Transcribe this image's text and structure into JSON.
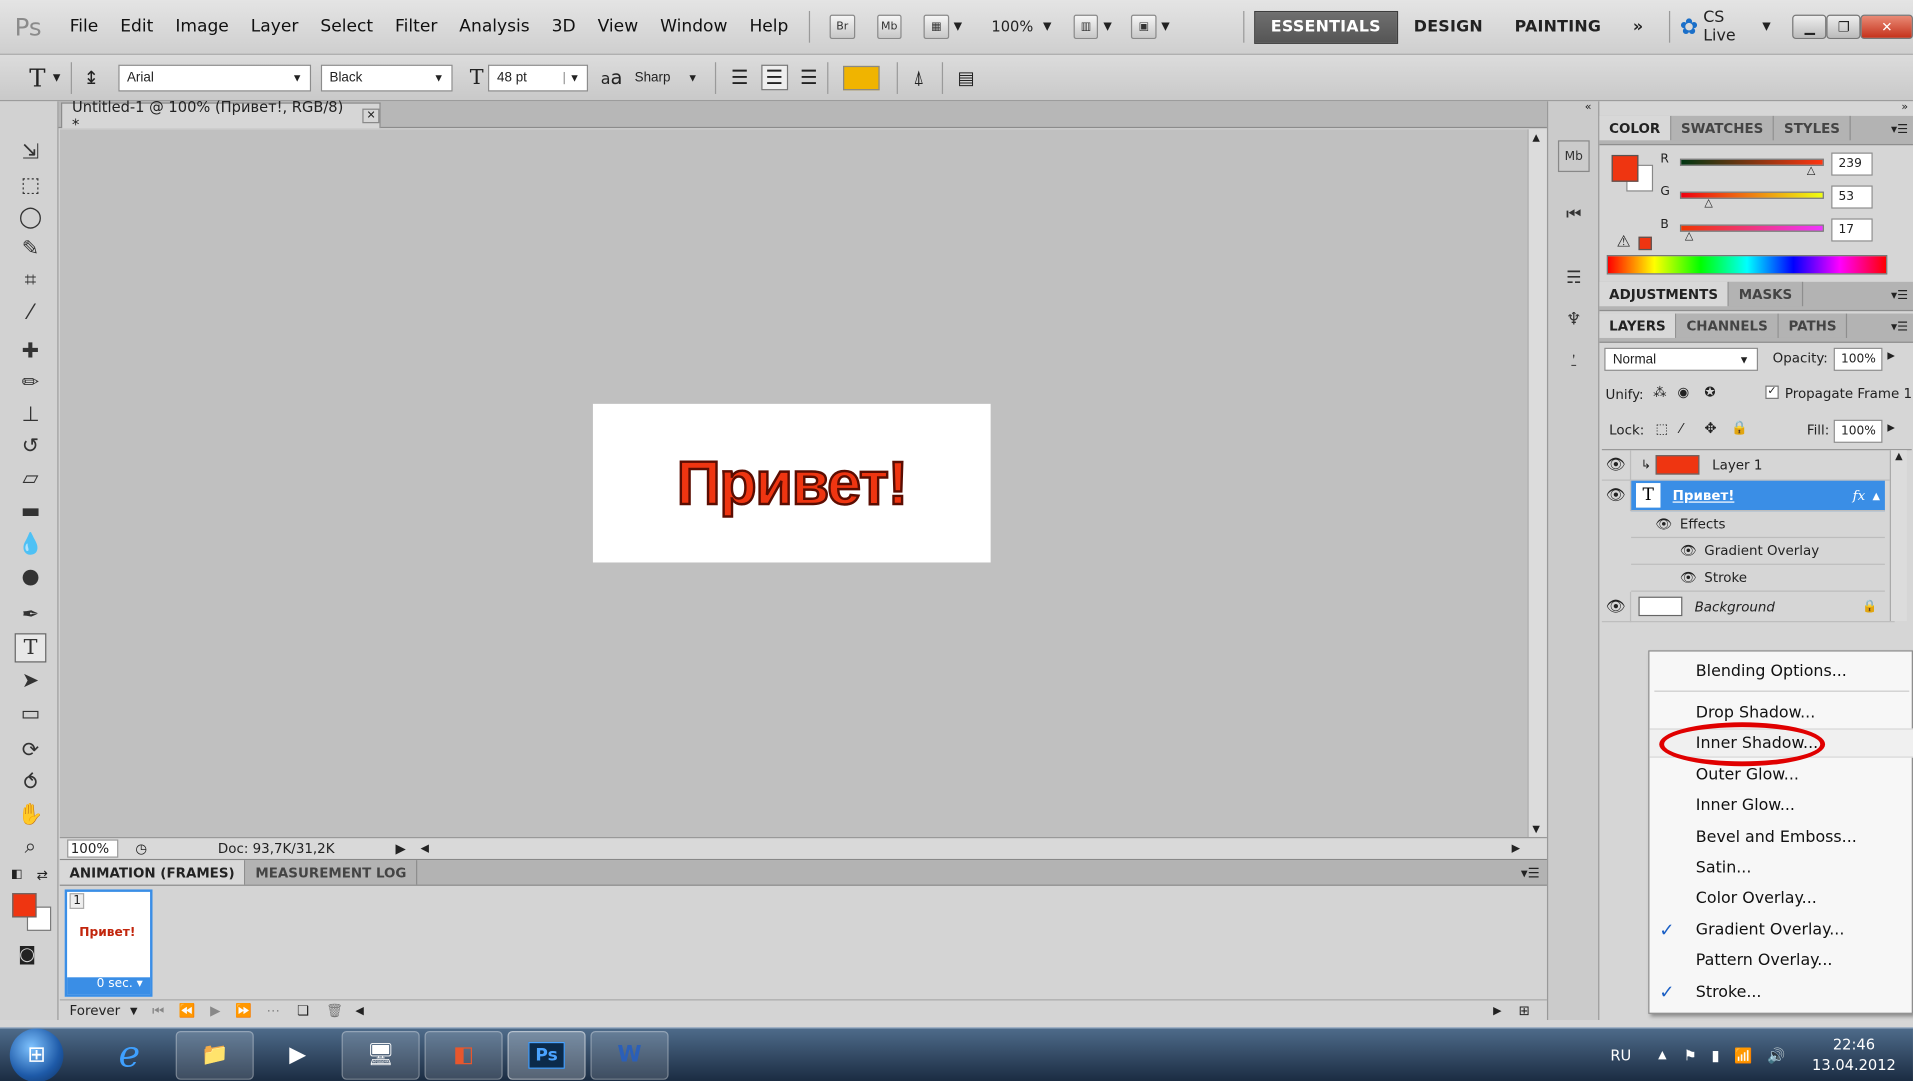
{
  "menubar": {
    "logo": "Ps",
    "items": [
      "File",
      "Edit",
      "Image",
      "Layer",
      "Select",
      "Filter",
      "Analysis",
      "3D",
      "View",
      "Window",
      "Help"
    ],
    "bridge": "Br",
    "minibridge": "Mb",
    "zoom": "100%",
    "workspaces": [
      "ESSENTIALS",
      "DESIGN",
      "PAINTING"
    ],
    "more": "»",
    "cslive": "CS Live"
  },
  "options": {
    "tool_glyph": "T",
    "font_family": "Arial",
    "font_style": "Black",
    "font_size": "48 pt",
    "aa_label": "a",
    "antialias": "Sharp",
    "text_color": "#f0b400"
  },
  "document": {
    "tab_title": "Untitled-1 @ 100% (Привет!, RGB/8) *",
    "close_glyph": "✕",
    "text": "Привет!",
    "text_color": "#ef3511"
  },
  "status": {
    "zoom": "100%",
    "doc": "Doc: 93,7K/31,2K"
  },
  "animation": {
    "tabs": [
      "ANIMATION (FRAMES)",
      "MEASUREMENT LOG"
    ],
    "frame_number": "1",
    "frame_text": "Привет!",
    "frame_delay": "0 sec.",
    "loop": "Forever"
  },
  "color_panel": {
    "tabs": [
      "COLOR",
      "SWATCHES",
      "STYLES"
    ],
    "fg_color": "#ef3511",
    "channels": [
      {
        "label": "R",
        "value": "239"
      },
      {
        "label": "G",
        "value": "53"
      },
      {
        "label": "B",
        "value": "17"
      }
    ]
  },
  "adjustments": {
    "tabs": [
      "ADJUSTMENTS",
      "MASKS"
    ]
  },
  "layers_panel": {
    "tabs": [
      "LAYERS",
      "CHANNELS",
      "PATHS"
    ],
    "blend_mode": "Normal",
    "opacity_label": "Opacity:",
    "opacity": "100%",
    "unify_label": "Unify:",
    "propagate": "Propagate Frame 1",
    "lock_label": "Lock:",
    "fill_label": "Fill:",
    "fill": "100%",
    "layers": [
      {
        "name": "Layer 1"
      },
      {
        "name": "Привет!",
        "fx": "fx"
      },
      {
        "name": "Effects"
      },
      {
        "name": "Gradient Overlay"
      },
      {
        "name": "Stroke"
      },
      {
        "name": "Background"
      }
    ]
  },
  "context_menu": {
    "items": [
      {
        "label": "Blending Options...",
        "checked": false
      },
      {
        "label": "Drop Shadow...",
        "checked": false
      },
      {
        "label": "Inner Shadow...",
        "checked": false
      },
      {
        "label": "Outer Glow...",
        "checked": false
      },
      {
        "label": "Inner Glow...",
        "checked": false
      },
      {
        "label": "Bevel and Emboss...",
        "checked": false
      },
      {
        "label": "Satin...",
        "checked": false
      },
      {
        "label": "Color Overlay...",
        "checked": false
      },
      {
        "label": "Gradient Overlay...",
        "checked": true
      },
      {
        "label": "Pattern Overlay...",
        "checked": false
      },
      {
        "label": "Stroke...",
        "checked": true
      }
    ],
    "check_glyph": "✓",
    "highlight_color": "#e00000"
  },
  "taskbar": {
    "lang": "RU",
    "time": "22:46",
    "date": "13.04.2012",
    "ps_label": "Ps"
  }
}
